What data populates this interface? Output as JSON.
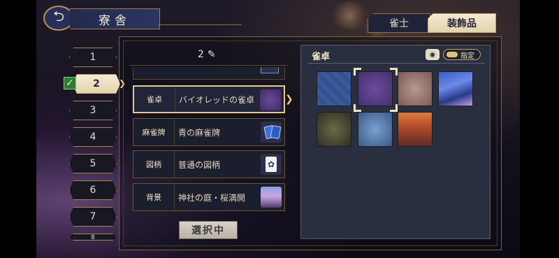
{
  "header": {
    "back_icon": "back-arrow-icon",
    "title": "寮舎"
  },
  "tabs": [
    {
      "label": "雀士",
      "active": false
    },
    {
      "label": "装飾品",
      "active": true
    }
  ],
  "slots": {
    "items": [
      "1",
      "2",
      "3",
      "4",
      "5",
      "6",
      "7",
      "8"
    ],
    "selected_index": 1,
    "check_icon": "✓"
  },
  "preset": {
    "number": "2",
    "edit_icon": "✎"
  },
  "items": [
    {
      "category": "雀卓",
      "name": "バイオレッドの雀卓",
      "selected": true,
      "thumb": "violet-table"
    },
    {
      "category": "麻雀牌",
      "name": "青の麻雀牌",
      "selected": false,
      "thumb": "blue-tiles"
    },
    {
      "category": "図柄",
      "name": "普通の図柄",
      "selected": false,
      "thumb": "tile-pattern"
    },
    {
      "category": "背景",
      "name": "神社の庭・桜満開",
      "selected": false,
      "thumb": "shrine-garden"
    }
  ],
  "select_button": "選択中",
  "panel": {
    "title": "雀卓",
    "eye_icon": "eye-icon",
    "spec_label": "指定",
    "selected_tile_index": 1,
    "tiles": [
      "blue-table",
      "violet-table",
      "rose-table",
      "starry-table",
      "forest-table",
      "ice-table",
      "sunset-table"
    ]
  },
  "colors": {
    "accent_gold": "#c4a468",
    "panel_bg": "#2a2f3f",
    "active_tab": "#f4ead3"
  }
}
